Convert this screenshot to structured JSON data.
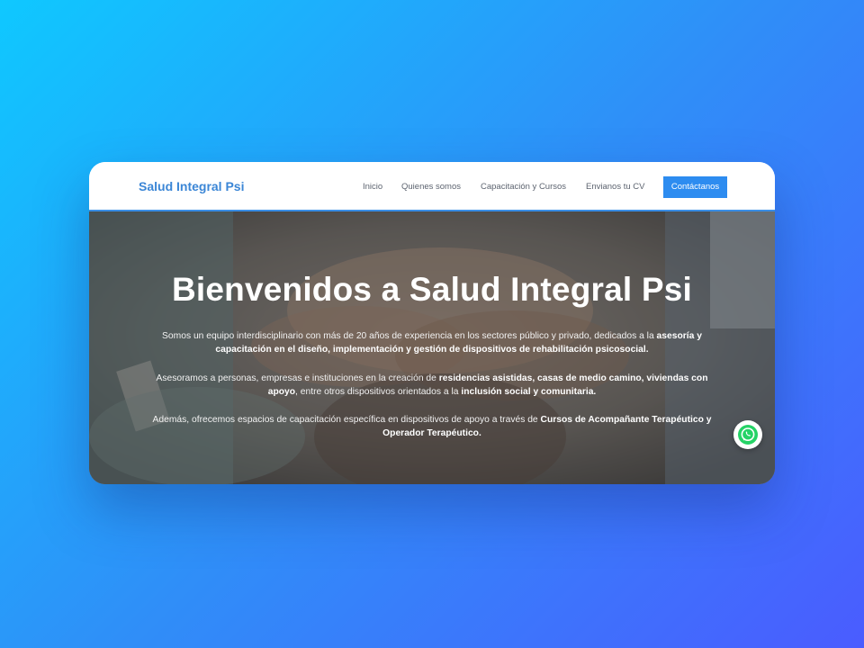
{
  "navbar": {
    "brand": "Salud Integral Psi",
    "links": [
      {
        "label": "Inicio"
      },
      {
        "label": "Quienes somos"
      },
      {
        "label": "Capacitación y Cursos"
      },
      {
        "label": "Envianos tu CV"
      }
    ],
    "cta_label": "Contáctanos"
  },
  "hero": {
    "title": "Bienvenidos a Salud Integral Psi",
    "paragraphs": [
      {
        "t1": "Somos un equipo interdisciplinario con más de 20 años de experiencia en los sectores público y privado, dedicados a la ",
        "b1": "asesoría y capacitación en el diseño, implementación y gestión de dispositivos de rehabilitación psicosocial."
      },
      {
        "t1": "Asesoramos a personas, empresas e instituciones en la creación de ",
        "b1": "residencias asistidas, casas de medio camino, viviendas con apoyo",
        "t2": ", entre otros dispositivos orientados a la ",
        "b2": "inclusión social y comunitaria."
      },
      {
        "t1": "Además, ofrecemos espacios de capacitación específica en dispositivos de apoyo a través de ",
        "b1": "Cursos de Acompañante Terapéutico y Operador Terapéutico."
      }
    ]
  },
  "floating": {
    "icon": "whatsapp-icon",
    "color": "#25d366"
  },
  "colors": {
    "accent": "#2d8cf0",
    "brand": "#3b86d6"
  }
}
